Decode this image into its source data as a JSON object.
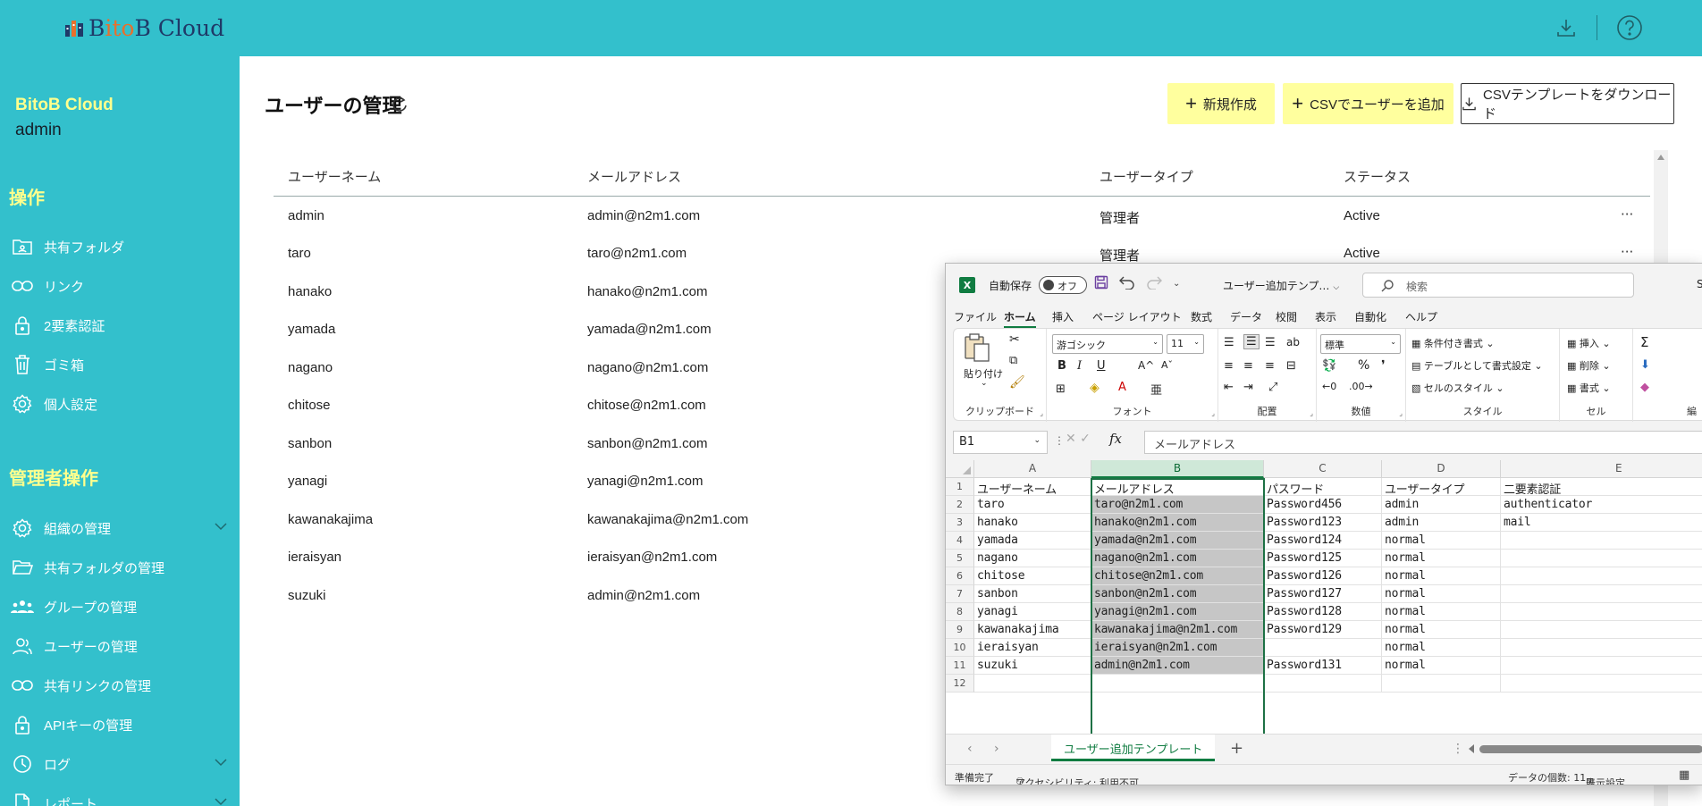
{
  "header": {
    "logo_text_b": "B",
    "logo_text_ito": "ito",
    "logo_text_rest": "B Cloud"
  },
  "sidebar": {
    "brand": "BitoB Cloud",
    "account": "admin",
    "section1": "操作",
    "items1": [
      {
        "label": "共有フォルダ",
        "icon": "shared-folder-icon"
      },
      {
        "label": "リンク",
        "icon": "link-icon"
      },
      {
        "label": "2要素認証",
        "icon": "lock-icon"
      },
      {
        "label": "ゴミ箱",
        "icon": "trash-icon"
      },
      {
        "label": "個人設定",
        "icon": "gear-icon"
      }
    ],
    "section2": "管理者操作",
    "items2": [
      {
        "label": "組織の管理",
        "icon": "gear-icon"
      },
      {
        "label": "共有フォルダの管理",
        "icon": "folder-open-icon"
      },
      {
        "label": "グループの管理",
        "icon": "group-icon"
      },
      {
        "label": "ユーザーの管理",
        "icon": "user-icon"
      },
      {
        "label": "共有リンクの管理",
        "icon": "link-icon"
      },
      {
        "label": "APIキーの管理",
        "icon": "lock-icon"
      },
      {
        "label": "ログ",
        "icon": "clock-icon"
      },
      {
        "label": "レポート",
        "icon": "document-icon"
      }
    ]
  },
  "page": {
    "title": "ユーザーの管理",
    "buttons": {
      "new": "新規作成",
      "csv_add": "CSVでユーザーを追加",
      "csv_template": "CSVテンプレートをダウンロード"
    },
    "columns": [
      "ユーザーネーム",
      "メールアドレス",
      "ユーザータイプ",
      "ステータス"
    ],
    "rows": [
      {
        "name": "admin",
        "email": "admin@n2m1.com",
        "type": "管理者",
        "status": "Active",
        "more": "···"
      },
      {
        "name": "taro",
        "email": "taro@n2m1.com",
        "type": "管理者",
        "status": "Active",
        "more": "···"
      },
      {
        "name": "hanako",
        "email": "hanako@n2m1.com"
      },
      {
        "name": "yamada",
        "email": "yamada@n2m1.com"
      },
      {
        "name": "nagano",
        "email": "nagano@n2m1.com"
      },
      {
        "name": "chitose",
        "email": "chitose@n2m1.com"
      },
      {
        "name": "sanbon",
        "email": "sanbon@n2m1.com"
      },
      {
        "name": "yanagi",
        "email": "yanagi@n2m1.com"
      },
      {
        "name": "kawanakajima",
        "email": "kawanakajima@n2m1.com"
      },
      {
        "name": "ieraisyan",
        "email": "ieraisyan@n2m1.com"
      },
      {
        "name": "suzuki",
        "email": "admin@n2m1.com"
      }
    ]
  },
  "excel": {
    "app_icon": "X",
    "autosave": "自動保存",
    "toggle": "オフ",
    "filename": "ユーザー追加テンプ…",
    "search": "検索",
    "cut_right": "S",
    "menu": [
      "ファイル",
      "ホーム",
      "挿入",
      "ページ レイアウト",
      "数式",
      "データ",
      "校閲",
      "表示",
      "自動化",
      "ヘルプ"
    ],
    "ribbon": {
      "paste": "貼り付け",
      "clipboard": "クリップボード",
      "font_name": "游ゴシック",
      "font_size": "11",
      "font": "フォント",
      "bold": "B",
      "italic": "I",
      "underline": "U",
      "grow": "A^",
      "shrink": "Aˇ",
      "align": "配置",
      "number_format": "標準",
      "number": "数値",
      "pct": "%",
      "comma": "❜",
      "cond_format": "条件付き書式",
      "table_format": "テーブルとして書式設定",
      "cell_style": "セルのスタイル",
      "style": "スタイル",
      "insert": "挿入",
      "delete": "削除",
      "format": "書式",
      "cells": "セル",
      "sigma": "Σ",
      "cut_label": "編"
    },
    "namebox": "B1",
    "formula": "メールアドレス",
    "col_headers": [
      "A",
      "B",
      "C",
      "D",
      "E"
    ],
    "row_numbers": [
      "1",
      "2",
      "3",
      "4",
      "5",
      "6",
      "7",
      "8",
      "9",
      "10",
      "11",
      "12"
    ],
    "grid": [
      [
        "ユーザーネーム",
        "メールアドレス",
        "パスワード",
        "ユーザータイプ",
        "二要素認証"
      ],
      [
        "taro",
        "taro@n2m1.com",
        "Password456",
        "admin",
        "authenticator"
      ],
      [
        "hanako",
        "hanako@n2m1.com",
        "Password123",
        "admin",
        "mail"
      ],
      [
        "yamada",
        "yamada@n2m1.com",
        "Password124",
        "normal",
        ""
      ],
      [
        "nagano",
        "nagano@n2m1.com",
        "Password125",
        "normal",
        ""
      ],
      [
        "chitose",
        "chitose@n2m1.com",
        "Password126",
        "normal",
        ""
      ],
      [
        "sanbon",
        "sanbon@n2m1.com",
        "Password127",
        "normal",
        ""
      ],
      [
        "yanagi",
        "yanagi@n2m1.com",
        "Password128",
        "normal",
        ""
      ],
      [
        "kawanakajima",
        "kawanakajima@n2m1.com",
        "Password129",
        "normal",
        ""
      ],
      [
        "ieraisyan",
        "ieraisyan@n2m1.com",
        "",
        "normal",
        ""
      ],
      [
        "suzuki",
        "admin@n2m1.com",
        "Password131",
        "normal",
        ""
      ]
    ],
    "sheet_tab": "ユーザー追加テンプレート",
    "add_sheet": "+",
    "status_ready": "準備完了",
    "accessibility": "アクセシビリティ: 利用不可",
    "count": "データの個数: 11",
    "view_settings": "表示設定"
  }
}
